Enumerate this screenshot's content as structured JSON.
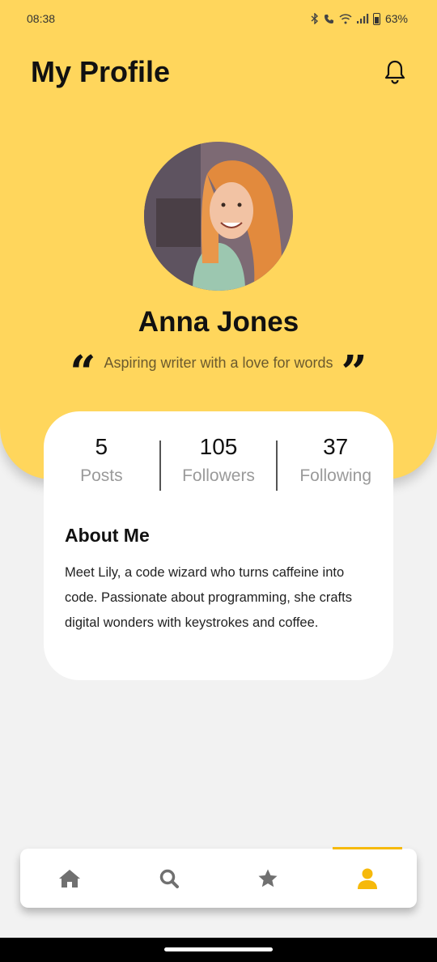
{
  "status": {
    "time": "08:38",
    "battery": "63%"
  },
  "header": {
    "title": "My Profile"
  },
  "profile": {
    "name": "Anna Jones",
    "bio": "Aspiring writer with a love for words",
    "open_quote": "“",
    "close_quote": "”"
  },
  "stats": [
    {
      "value": "5",
      "label": "Posts"
    },
    {
      "value": "105",
      "label": "Followers"
    },
    {
      "value": "37",
      "label": "Following"
    }
  ],
  "about": {
    "title": "About Me",
    "text": "Meet Lily, a code wizard who turns caffeine into code. Passionate about programming, she crafts digital wonders with keystrokes and coffee."
  },
  "nav": {
    "items": [
      {
        "icon": "home-icon"
      },
      {
        "icon": "search-icon"
      },
      {
        "icon": "star-icon"
      },
      {
        "icon": "profile-icon",
        "active": true
      }
    ]
  },
  "colors": {
    "accent": "#ffd65c",
    "active": "#f6b90b",
    "inactive": "#707070"
  }
}
